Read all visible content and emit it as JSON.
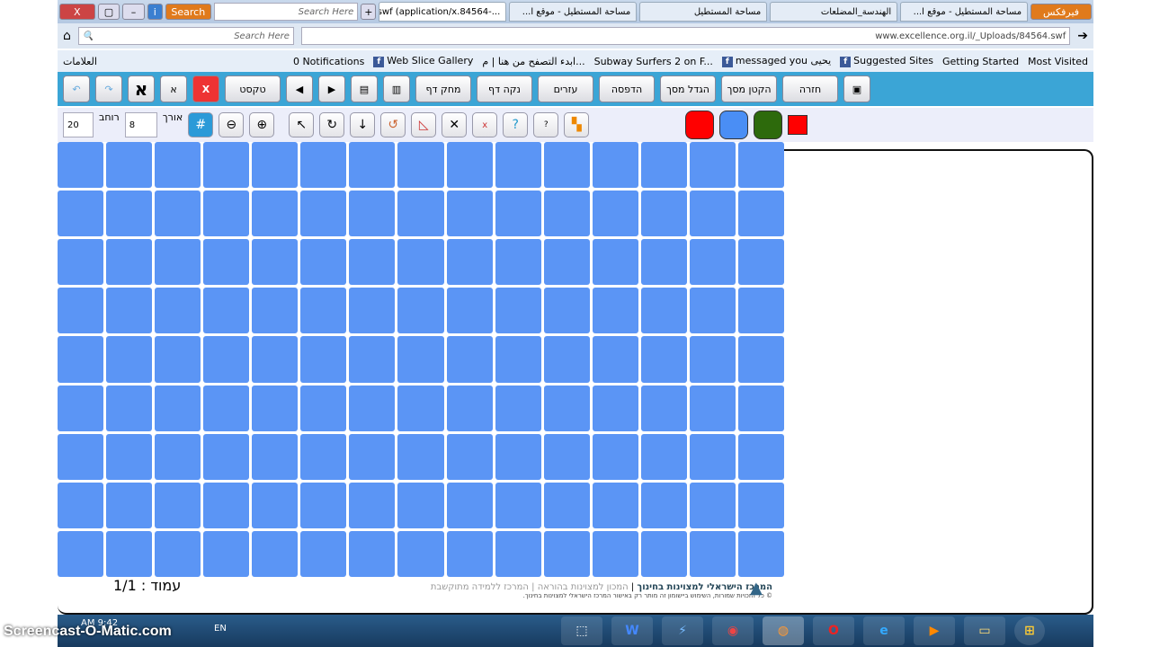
{
  "browser": {
    "window_controls": {
      "close": "X",
      "restore": "▢",
      "minimize": "–"
    },
    "search_button": "Search",
    "search_placeholder": "Search Here",
    "tabs": [
      {
        "label": "...-swf (application/x.84564",
        "active": true
      },
      {
        "label": "مساحة المستطيل - موقع ا..."
      },
      {
        "label": "مساحة المستطيل"
      },
      {
        "label": "الهندسة_المضلعات"
      },
      {
        "label": "مساحة المستطيل - موقع ا..."
      }
    ],
    "firefox_button": "فيرفكس",
    "url": "www.excellence.org.il/_Uploads/84564.swf",
    "nav_search_placeholder": "Search Here",
    "bookmarks": [
      "0 Notifications",
      "Web Slice Gallery",
      "ابدء التصفح من هنا | م...",
      "Subway Surfers 2 on F...",
      "messaged you يحيى",
      "Suggested Sites",
      "Getting Started",
      "Most Visited"
    ],
    "bookmarks_folder": "العلامات"
  },
  "toolbar": {
    "alef_big": "א",
    "alef_small": "א",
    "text_button": "טקסט",
    "buttons": [
      "מחק דף",
      "נקה דף",
      "עזרים",
      "הדפסה",
      "הגדל מסך",
      "הקטן מסך",
      "חזרה"
    ]
  },
  "tools": {
    "width_label": "רוחב",
    "width_value": "20",
    "length_label": "אורך",
    "length_value": "8",
    "colors": [
      "#ff0000",
      "#4a8ef5",
      "#2d6a0c",
      "#ff0000"
    ]
  },
  "grid": {
    "rows": 9,
    "cols": 15,
    "cell_color": "#5b95f5"
  },
  "footer": {
    "page_label": "עמוד : 1/1",
    "org_name": "המרכז הישראלי למצוינות בחינוך",
    "org_links": "המכון למצוינות בהוראה | המרכז ללמידה מתוקשבת",
    "copyright": "© כל הזכויות שמורות, השימוש ביישומון זה מותר רק באישור המרכז הישראלי למצוינות בחינוך."
  },
  "taskbar": {
    "time": "AM 9:42",
    "lang": "EN",
    "apps": [
      "snip",
      "word",
      "app",
      "chrome",
      "firefox",
      "opera",
      "ie",
      "media",
      "explorer"
    ]
  },
  "watermark": "Screencast-O-Matic.com"
}
